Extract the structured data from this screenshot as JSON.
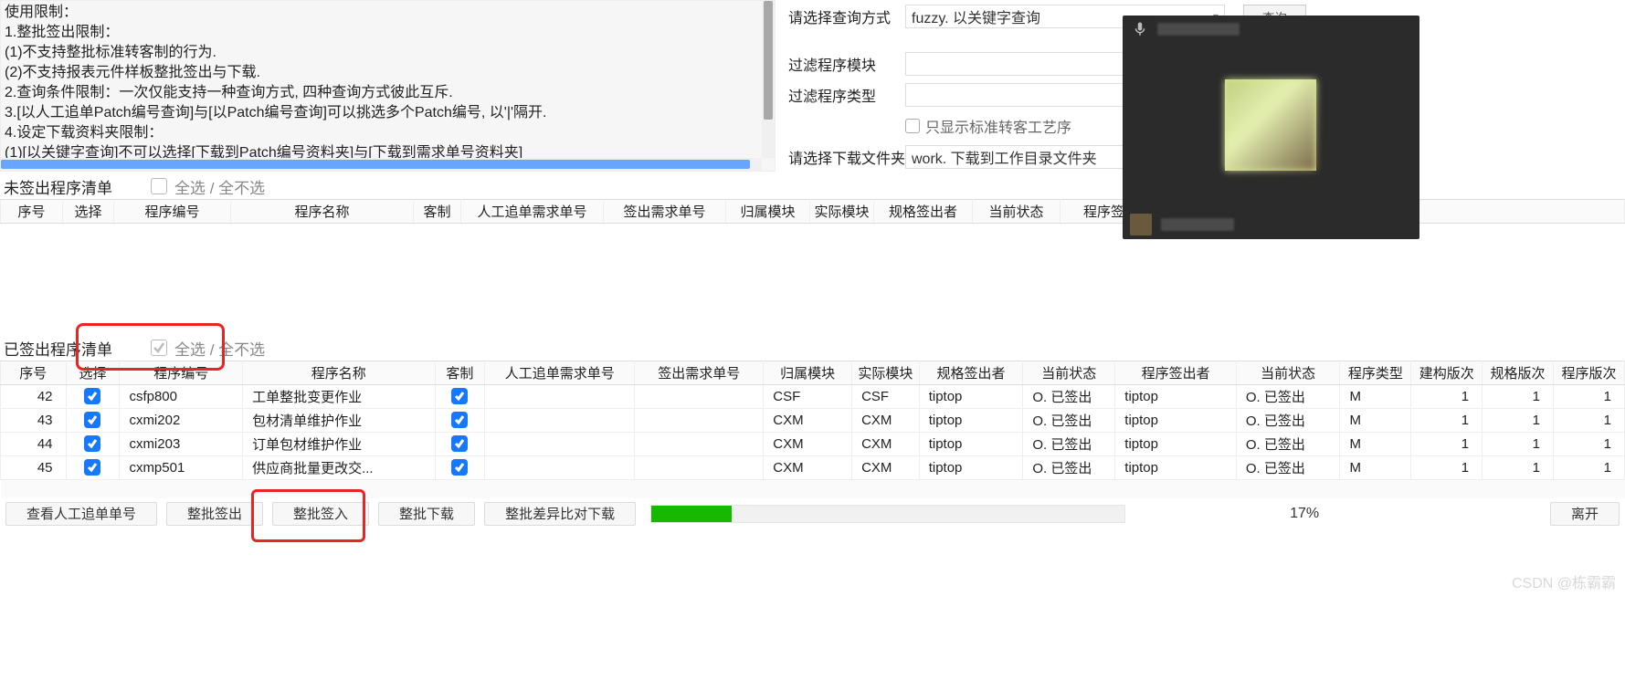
{
  "rules": [
    "使用限制：",
    "1.整批签出限制：",
    "(1)不支持整批标准转客制的行为.",
    "(2)不支持报表元件样板整批签出与下载.",
    "2.查询条件限制：一次仅能支持一种查询方式, 四种查询方式彼此互斥.",
    "3.[以人工追单Patch编号查询]与[以Patch编号查询]可以挑选多个Patch编号, 以'|'隔开.",
    "4.设定下载资料夹限制：",
    "(1)[以关键字查询]不可以选择[下载到Patch编号资料夹]与[下载到需求单号资料夹]"
  ],
  "filters": {
    "query_mode": {
      "label": "请选择查询方式",
      "value": "fuzzy. 以关键字查询"
    },
    "module": {
      "label": "过滤程序模块",
      "value": ""
    },
    "type": {
      "label": "过滤程序类型",
      "value": ""
    },
    "std_only": "只显示标准转客工艺序",
    "download": {
      "label": "请选择下载文件夹",
      "value": "work. 下载到工作目录文件夹"
    }
  },
  "buttons": {
    "query": "查询",
    "view_track": "查看人工追单单号",
    "batch_out": "整批签出",
    "batch_in": "整批签入",
    "batch_dl": "整批下载",
    "batch_diff": "整批差异比对下载",
    "exit": "离开"
  },
  "sections": {
    "top": {
      "title": "未签出程序清单"
    },
    "bottom": {
      "title": "已签出程序清单"
    },
    "select_all": "全选 / 全不选"
  },
  "columns": {
    "0": "序号",
    "1": "选择",
    "2": "程序编号",
    "3": "程序名称",
    "4": "客制",
    "5": "人工追单需求单号",
    "6": "签出需求单号",
    "7": "归属模块",
    "8": "实际模块",
    "9": "规格签出者",
    "10": "当前状态",
    "11": "程序签出者",
    "12": "当前状态",
    "12_trunc": "当",
    "13": "程序类型",
    "14": "建构版次",
    "15": "规格版次",
    "16": "程序版次"
  },
  "columns_extra": {
    "t12_trunc": "当"
  },
  "rows": [
    {
      "seq": 42,
      "code": "csfp800",
      "name": "工单整批变更作业",
      "om": "CSF",
      "am": "CSF",
      "ss": "tiptop",
      "st": "O. 已签出",
      "ps": "tiptop",
      "st2": "O. 已签出",
      "ptype": "M",
      "bv": 1,
      "sv": 1,
      "pv": 1
    },
    {
      "seq": 43,
      "code": "cxmi202",
      "name": "包材清单维护作业",
      "om": "CXM",
      "am": "CXM",
      "ss": "tiptop",
      "st": "O. 已签出",
      "ps": "tiptop",
      "st2": "O. 已签出",
      "ptype": "M",
      "bv": 1,
      "sv": 1,
      "pv": 1
    },
    {
      "seq": 44,
      "code": "cxmi203",
      "name": "订单包材维护作业",
      "om": "CXM",
      "am": "CXM",
      "ss": "tiptop",
      "st": "O. 已签出",
      "ps": "tiptop",
      "st2": "O. 已签出",
      "ptype": "M",
      "bv": 1,
      "sv": 1,
      "pv": 1
    },
    {
      "seq": 45,
      "code": "cxmp501",
      "name": "供应商批量更改交...",
      "om": "CXM",
      "am": "CXM",
      "ss": "tiptop",
      "st": "O. 已签出",
      "ps": "tiptop",
      "st2": "O. 已签出",
      "ptype": "M",
      "bv": 1,
      "sv": 1,
      "pv": 1
    }
  ],
  "progress": {
    "percent": 17,
    "label": "17%"
  },
  "watermark": "CSDN @栋霸霸"
}
